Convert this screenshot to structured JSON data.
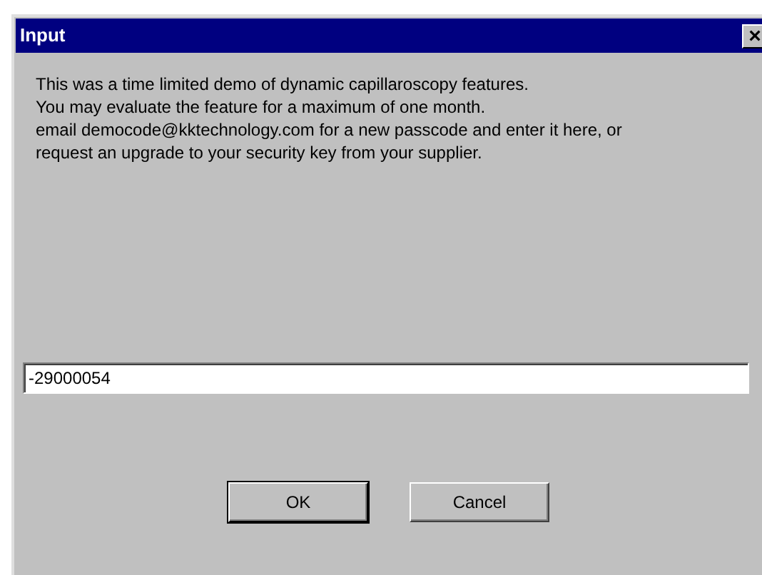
{
  "window": {
    "title": "Input",
    "close": "×"
  },
  "message": [
    "This was a time limited demo of dynamic capillaroscopy features.",
    "You may evaluate the feature for a maximum of one month.",
    "email democode@kktechnology.com for a new passcode and enter it here, or",
    "request an upgrade to your security key from your supplier."
  ],
  "input": {
    "value": "-29000054"
  },
  "buttons": [
    {
      "label": "OK",
      "default": true
    },
    {
      "label": "Cancel",
      "default": false
    }
  ]
}
